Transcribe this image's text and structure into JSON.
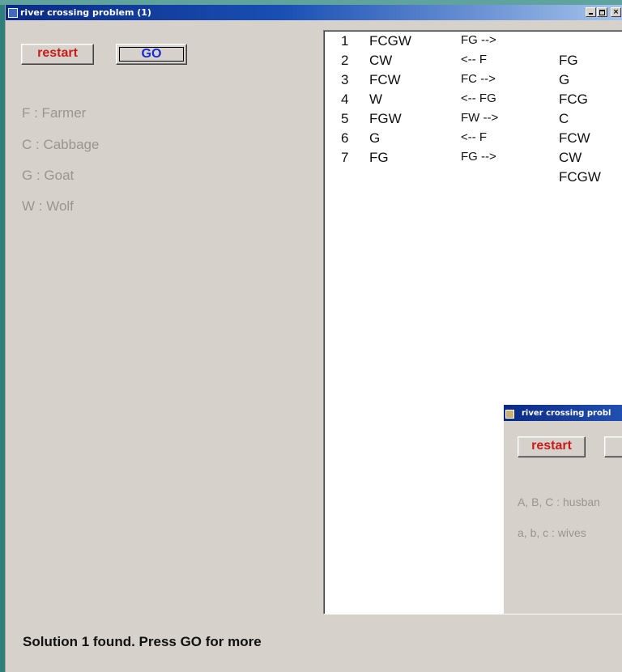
{
  "window": {
    "title": "river crossing problem (1)",
    "controls": {
      "minimize": "_",
      "maximize": "□",
      "close": "×"
    }
  },
  "buttons": {
    "restart": "restart",
    "go": "GO"
  },
  "legend": [
    "F : Farmer",
    "C : Cabbage",
    "G : Goat",
    "W : Wolf"
  ],
  "solution": {
    "rows": [
      {
        "num": "1",
        "left": "FCGW",
        "move": "FG -->",
        "right": ""
      },
      {
        "num": "2",
        "left": "CW",
        "move": "<-- F",
        "right": "FG"
      },
      {
        "num": "3",
        "left": "FCW",
        "move": "FC -->",
        "right": "G"
      },
      {
        "num": "4",
        "left": "W",
        "move": "<-- FG",
        "right": "FCG"
      },
      {
        "num": "5",
        "left": "FGW",
        "move": "FW -->",
        "right": "C"
      },
      {
        "num": "6",
        "left": "G",
        "move": "<-- F",
        "right": "FCW"
      },
      {
        "num": "7",
        "left": "FG",
        "move": "FG -->",
        "right": "CW"
      }
    ],
    "final_right": "FCGW"
  },
  "status": "Solution 1 found. Press GO for more",
  "window2": {
    "title": "river crossing probl",
    "restart": "restart",
    "legend": [
      "A, B, C : husban",
      "a, b, c : wives"
    ]
  },
  "colors": {
    "accent_red": "#cc1a1a",
    "accent_blue": "#1a2bd0",
    "desktop": "#2e7f7c",
    "titlebar": "#0a2a85"
  }
}
